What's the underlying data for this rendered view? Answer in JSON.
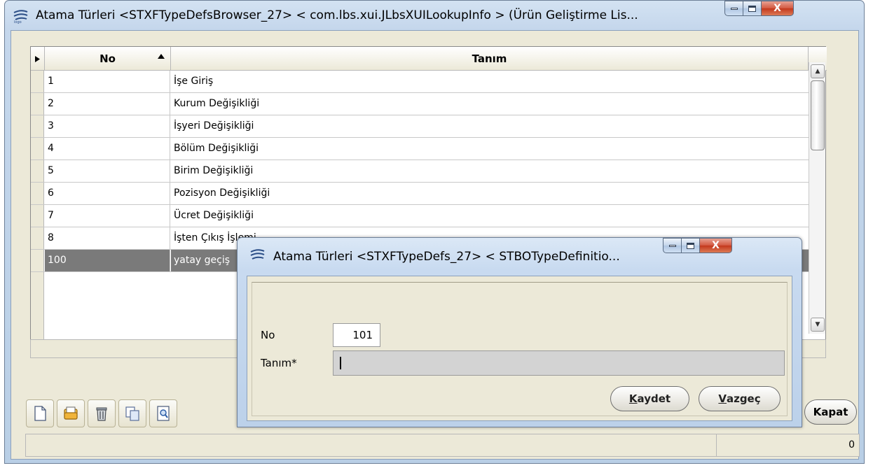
{
  "main_window": {
    "title": "Atama Türleri <STXFTypeDefsBrowser_27> < com.lbs.xui.JLbsXUILookupInfo > (Ürün Geliştirme Lis...",
    "close_glyph": "X"
  },
  "grid": {
    "columns": [
      {
        "label": "No",
        "sort": "ascending"
      },
      {
        "label": "Tanım"
      }
    ],
    "rows": [
      {
        "no": "1",
        "tanim": "İşe Giriş"
      },
      {
        "no": "2",
        "tanim": "Kurum Değişikliği"
      },
      {
        "no": "3",
        "tanim": "İşyeri Değişikliği"
      },
      {
        "no": "4",
        "tanim": "Bölüm Değişikliği"
      },
      {
        "no": "5",
        "tanim": "Birim Değişikliği"
      },
      {
        "no": "6",
        "tanim": "Pozisyon Değişikliği"
      },
      {
        "no": "7",
        "tanim": "Ücret Değişikliği"
      },
      {
        "no": "8",
        "tanim": "İşten Çıkış İşlemi"
      },
      {
        "no": "100",
        "tanim": "yatay geçiş",
        "selected": true
      }
    ]
  },
  "toolbar": {
    "icons": [
      "new-record-icon",
      "open-record-icon",
      "delete-icon",
      "copy-icon",
      "view-record-icon"
    ]
  },
  "kapat_label": "Kapat",
  "status": {
    "count": "0"
  },
  "dialog": {
    "title": "Atama Türleri <STXFTypeDefs_27> < STBOTypeDefinitio...",
    "close_glyph": "X",
    "no_label": "No",
    "no_value": "101",
    "tanim_label": "Tanım*",
    "tanim_value": "",
    "save_mnemonic": "K",
    "save_rest": "aydet",
    "cancel_mnemonic": "V",
    "cancel_rest": "azgeç"
  },
  "colors": {
    "title_gradient_top": "#d3e2f2",
    "client_background": "#ece9d8",
    "selected_row": "#7a7a7a",
    "close_button": "#c3381d"
  }
}
